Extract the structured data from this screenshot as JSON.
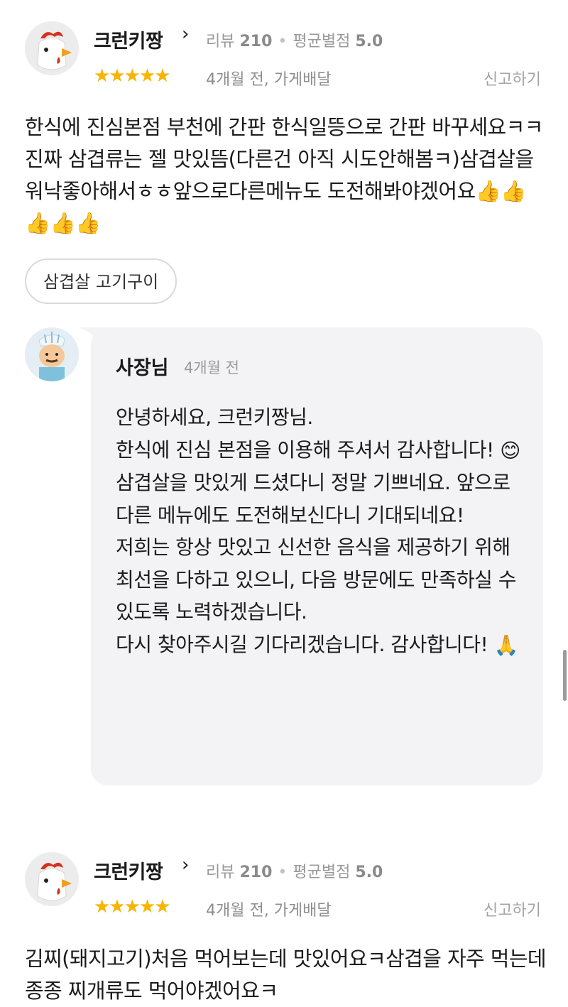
{
  "reviews": [
    {
      "nickname": "크런키짱",
      "chevron": "›",
      "review_label": "리뷰",
      "review_count": "210",
      "avg_label": "평균별점",
      "avg_rating": "5.0",
      "stars": "★★★★★",
      "rating": 5,
      "meta": "4개월 전, 가게배달",
      "report": "신고하기",
      "text": "한식에 진심본점 부천에 간판 한식일뜽으로 간판 바꾸세요ㅋㅋ 진짜 삼겹류는 젤 맛있뜸(다른건 아직 시도안해봄ㅋ)삼겹살을 워낙좋아해서ㅎㅎ앞으로다른메뉴도 도전해봐야겠어요",
      "thumbs": "👍👍👍👍👍",
      "menu_tag": "삼겹살 고기구이"
    },
    {
      "nickname": "크런키짱",
      "chevron": "›",
      "review_label": "리뷰",
      "review_count": "210",
      "avg_label": "평균별점",
      "avg_rating": "5.0",
      "stars": "★★★★★",
      "rating": 5,
      "meta": "4개월 전, 가게배달",
      "report": "신고하기",
      "text": "김찌(돼지고기)처음 먹어보는데 맛있어요ㅋ삼겹을 자주 먹는데 종종 찌개류도 먹어야겠어요ㅋ"
    }
  ],
  "reply": {
    "owner": "사장님",
    "time": "4개월 전",
    "line1": "안녕하세요, 크런키짱님.",
    "line2": "한식에 진심 본점을 이용해 주셔서 감사합니다!",
    "emoji_smile": "😊",
    "line3": "삼겹살을 맛있게 드셨다니 정말 기쁘네요. 앞으로 다른 메뉴에도 도전해보신다니 기대되네요!",
    "line4": "저희는 항상 맛있고 신선한 음식을 제공하기 위해 최선을 다하고 있으니, 다음 방문에도 만족하실 수 있도록 노력하겠습니다.",
    "line5": "다시 찾아주시길 기다리겠습니다. 감사합니다!",
    "emoji_pray": "🙏"
  },
  "colors": {
    "star": "#f7b500",
    "reply_bg": "#f3f3f5",
    "muted_text": "#9a9a9a"
  }
}
